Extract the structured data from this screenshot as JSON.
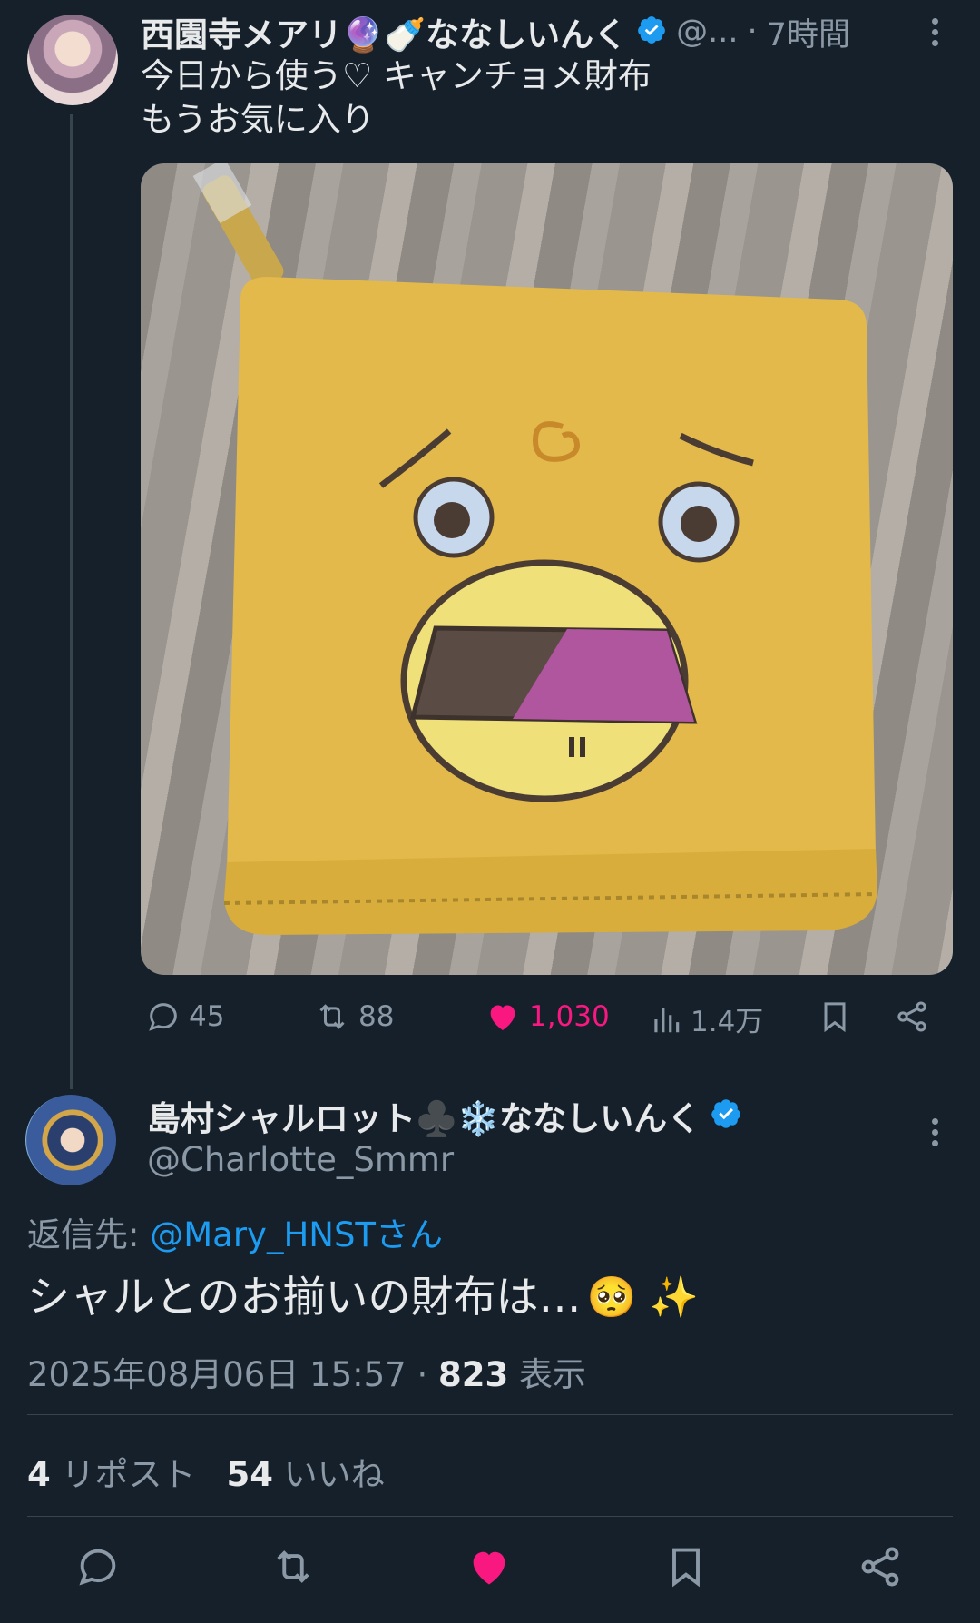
{
  "tweet1": {
    "display_name": "西園寺メアリ🔮🍼ななしいんく",
    "handle": "@...",
    "dot": "·",
    "time": "7時間",
    "text": "今日から使う♡ キャンチョメ財布\nもうお気に入り",
    "actions": {
      "reply_count": "45",
      "retweet_count": "88",
      "like_count": "1,030",
      "views_count": "1.4万"
    }
  },
  "tweet2": {
    "display_name": "島村シャルロット♣️❄️ななしいんく",
    "handle": "@Charlotte_Smmr",
    "reply_label": "返信先: ",
    "reply_target": "@Mary_HNSTさん",
    "text": "シャルとのお揃いの財布は…",
    "text_emoji": "🥺 ✨",
    "timestamp": "2025年08月06日 15:57",
    "meta_dot": " · ",
    "views": "823",
    "views_label": " 表示",
    "reposts": "4",
    "reposts_label": " リポスト",
    "likes": "54",
    "likes_label": " いいね"
  },
  "colors": {
    "background": "#15202b",
    "text": "#e7e9ea",
    "muted": "#8b98a5",
    "link": "#1d9bf0",
    "like": "#f91880",
    "verified": "#1d9bf0"
  },
  "icons": [
    "reply-icon",
    "retweet-icon",
    "heart-icon",
    "views-icon",
    "bookmark-icon",
    "share-icon",
    "more-icon",
    "verified-icon"
  ]
}
